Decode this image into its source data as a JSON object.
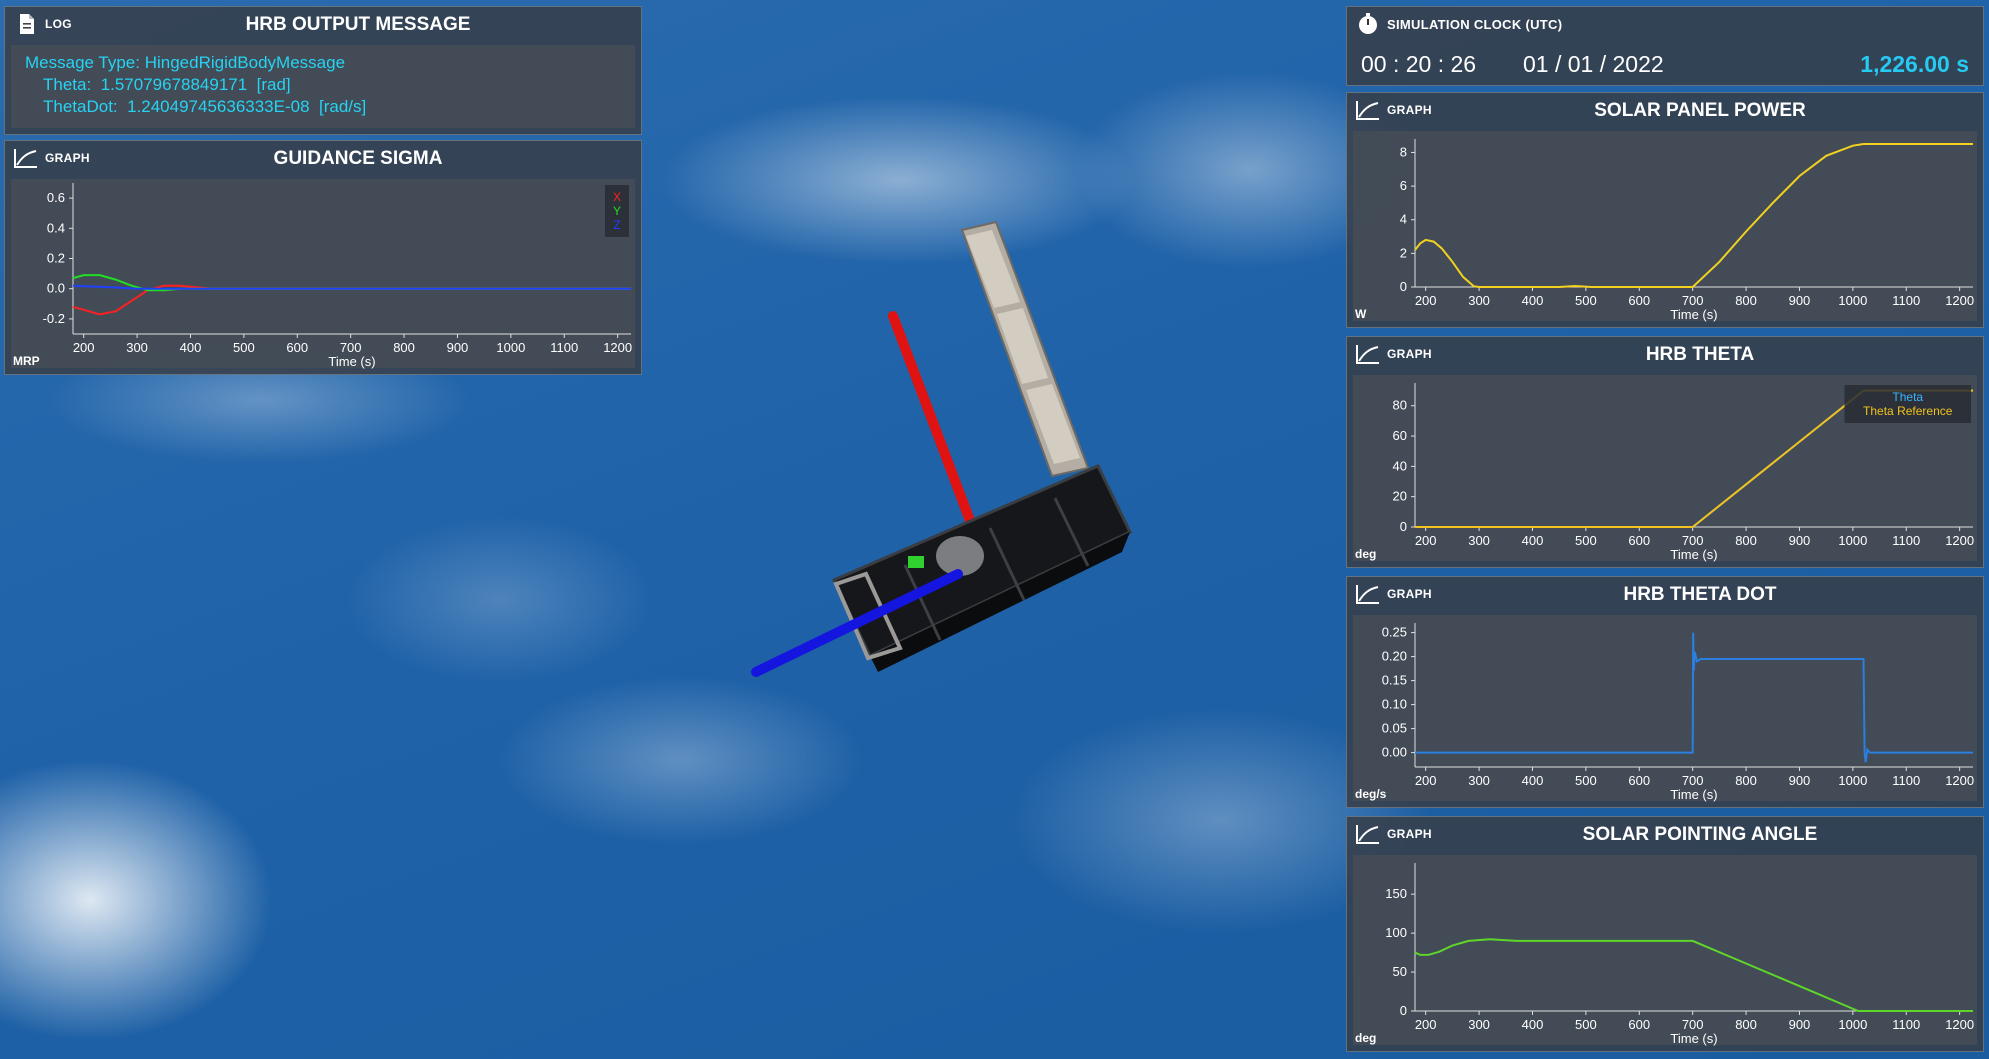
{
  "log": {
    "kind": "LOG",
    "title": "HRB OUTPUT MESSAGE",
    "lines": [
      "Message Type: HingedRigidBodyMessage",
      "Theta:  1.57079678849171  [rad]",
      "ThetaDot:  1.24049745636333E-08  [rad/s]"
    ]
  },
  "clock": {
    "title": "SIMULATION CLOCK (UTC)",
    "time": "00 : 20 : 26",
    "date": "01 / 01 / 2022",
    "elapsed": "1,226.00 s"
  },
  "graphs": [
    {
      "id": "guidance-sigma",
      "kind": "GRAPH",
      "title": "GUIDANCE SIGMA",
      "unit": "MRP",
      "chart_data": {
        "type": "line",
        "xlabel": "Time (s)",
        "xlim": [
          180,
          1225
        ],
        "ylim": [
          -0.3,
          0.7
        ],
        "xticks": [
          200,
          300,
          400,
          500,
          600,
          700,
          800,
          900,
          1000,
          1100,
          1200
        ],
        "yticks": [
          -0.2,
          0.0,
          0.2,
          0.4,
          0.6
        ],
        "ytick_labels": [
          "-0.2",
          "0.0",
          "0.2",
          "0.4",
          "0.6"
        ],
        "legend": "top-right",
        "series": [
          {
            "name": "X",
            "color": "#ff2020",
            "x": [
              180,
              200,
              230,
              260,
              290,
              320,
              350,
              380,
              410,
              440,
              500,
              1225
            ],
            "y": [
              -0.12,
              -0.14,
              -0.17,
              -0.15,
              -0.08,
              -0.01,
              0.02,
              0.02,
              0.01,
              0.0,
              0.0,
              0.0
            ]
          },
          {
            "name": "Y",
            "color": "#22dd22",
            "x": [
              180,
              200,
              230,
              260,
              290,
              320,
              350,
              380,
              410,
              500,
              1225
            ],
            "y": [
              0.07,
              0.09,
              0.09,
              0.06,
              0.02,
              -0.01,
              -0.01,
              0.0,
              0.0,
              0.0,
              0.0
            ]
          },
          {
            "name": "Z",
            "color": "#2040ff",
            "x": [
              180,
              250,
              300,
              500,
              1225
            ],
            "y": [
              0.02,
              0.01,
              0.0,
              0.0,
              0.0
            ]
          }
        ]
      }
    },
    {
      "id": "solar-panel-power",
      "kind": "GRAPH",
      "title": "SOLAR PANEL POWER",
      "unit": "W",
      "chart_data": {
        "type": "line",
        "xlabel": "Time (s)",
        "xlim": [
          180,
          1225
        ],
        "ylim": [
          0,
          8.8
        ],
        "xticks": [
          200,
          300,
          400,
          500,
          600,
          700,
          800,
          900,
          1000,
          1100,
          1200
        ],
        "yticks": [
          0,
          2,
          4,
          6,
          8
        ],
        "ytick_labels": [
          "0",
          "2",
          "4",
          "6",
          "8"
        ],
        "series": [
          {
            "color": "#f2d21e",
            "x": [
              180,
              190,
              200,
              215,
              230,
              250,
              270,
              290,
              300,
              450,
              480,
              510,
              700,
              750,
              800,
              850,
              900,
              950,
              1000,
              1020,
              1225
            ],
            "y": [
              2.2,
              2.6,
              2.8,
              2.7,
              2.3,
              1.5,
              0.6,
              0.05,
              0.0,
              0.0,
              0.06,
              0.0,
              0.0,
              1.5,
              3.3,
              5.0,
              6.6,
              7.8,
              8.4,
              8.5,
              8.5
            ]
          }
        ]
      }
    },
    {
      "id": "hrb-theta",
      "kind": "GRAPH",
      "title": "HRB THETA",
      "unit": "deg",
      "chart_data": {
        "type": "line",
        "xlabel": "Time (s)",
        "xlim": [
          180,
          1225
        ],
        "ylim": [
          0,
          95
        ],
        "xticks": [
          200,
          300,
          400,
          500,
          600,
          700,
          800,
          900,
          1000,
          1100,
          1200
        ],
        "yticks": [
          0,
          20,
          40,
          60,
          80
        ],
        "ytick_labels": [
          "0",
          "20",
          "40",
          "60",
          "80"
        ],
        "legend": "top-right",
        "series": [
          {
            "name": "Theta",
            "color": "#3ab4ff",
            "x": [
              180,
              700,
              1020,
              1225
            ],
            "y": [
              0.0,
              0.0,
              90.0,
              90.0
            ]
          },
          {
            "name": "Theta Reference",
            "color": "#f2c21e",
            "x": [
              180,
              700,
              1020,
              1225
            ],
            "y": [
              0.0,
              0.0,
              90.0,
              90.0
            ]
          }
        ]
      }
    },
    {
      "id": "hrb-theta-dot",
      "kind": "GRAPH",
      "title": "HRB THETA DOT",
      "unit": "deg/s",
      "chart_data": {
        "type": "line",
        "xlabel": "Time (s)",
        "xlim": [
          180,
          1225
        ],
        "ylim": [
          -0.03,
          0.27
        ],
        "xticks": [
          200,
          300,
          400,
          500,
          600,
          700,
          800,
          900,
          1000,
          1100,
          1200
        ],
        "yticks": [
          0.0,
          0.05,
          0.1,
          0.15,
          0.2,
          0.25
        ],
        "ytick_labels": [
          "0.00",
          "0.05",
          "0.10",
          "0.15",
          "0.20",
          "0.25"
        ],
        "series": [
          {
            "color": "#2a7fe0",
            "x": [
              180,
              700,
              701,
              702,
              704,
              708,
              715,
              1020,
              1022,
              1024,
              1027,
              1032,
              1225
            ],
            "y": [
              0.0,
              0.0,
              0.25,
              0.17,
              0.21,
              0.19,
              0.195,
              0.195,
              0.0,
              -0.02,
              0.006,
              0.0,
              0.0
            ]
          }
        ]
      }
    },
    {
      "id": "solar-pointing-angle",
      "kind": "GRAPH",
      "title": "SOLAR POINTING ANGLE",
      "unit": "deg",
      "chart_data": {
        "type": "line",
        "xlabel": "Time (s)",
        "xlim": [
          180,
          1225
        ],
        "ylim": [
          0,
          190
        ],
        "xticks": [
          200,
          300,
          400,
          500,
          600,
          700,
          800,
          900,
          1000,
          1100,
          1200
        ],
        "yticks": [
          0,
          50,
          100,
          150
        ],
        "ytick_labels": [
          "0",
          "50",
          "100",
          "150"
        ],
        "series": [
          {
            "color": "#5ed62a",
            "x": [
              180,
              190,
              205,
              225,
              250,
              280,
              320,
              370,
              450,
              700,
              800,
              900,
              1010,
              1225
            ],
            "y": [
              75.0,
              72.0,
              72.0,
              76.0,
              84.0,
              90.0,
              92.0,
              90.0,
              90.0,
              90.0,
              61.0,
              32.0,
              0.0,
              0.0
            ]
          }
        ]
      }
    }
  ]
}
